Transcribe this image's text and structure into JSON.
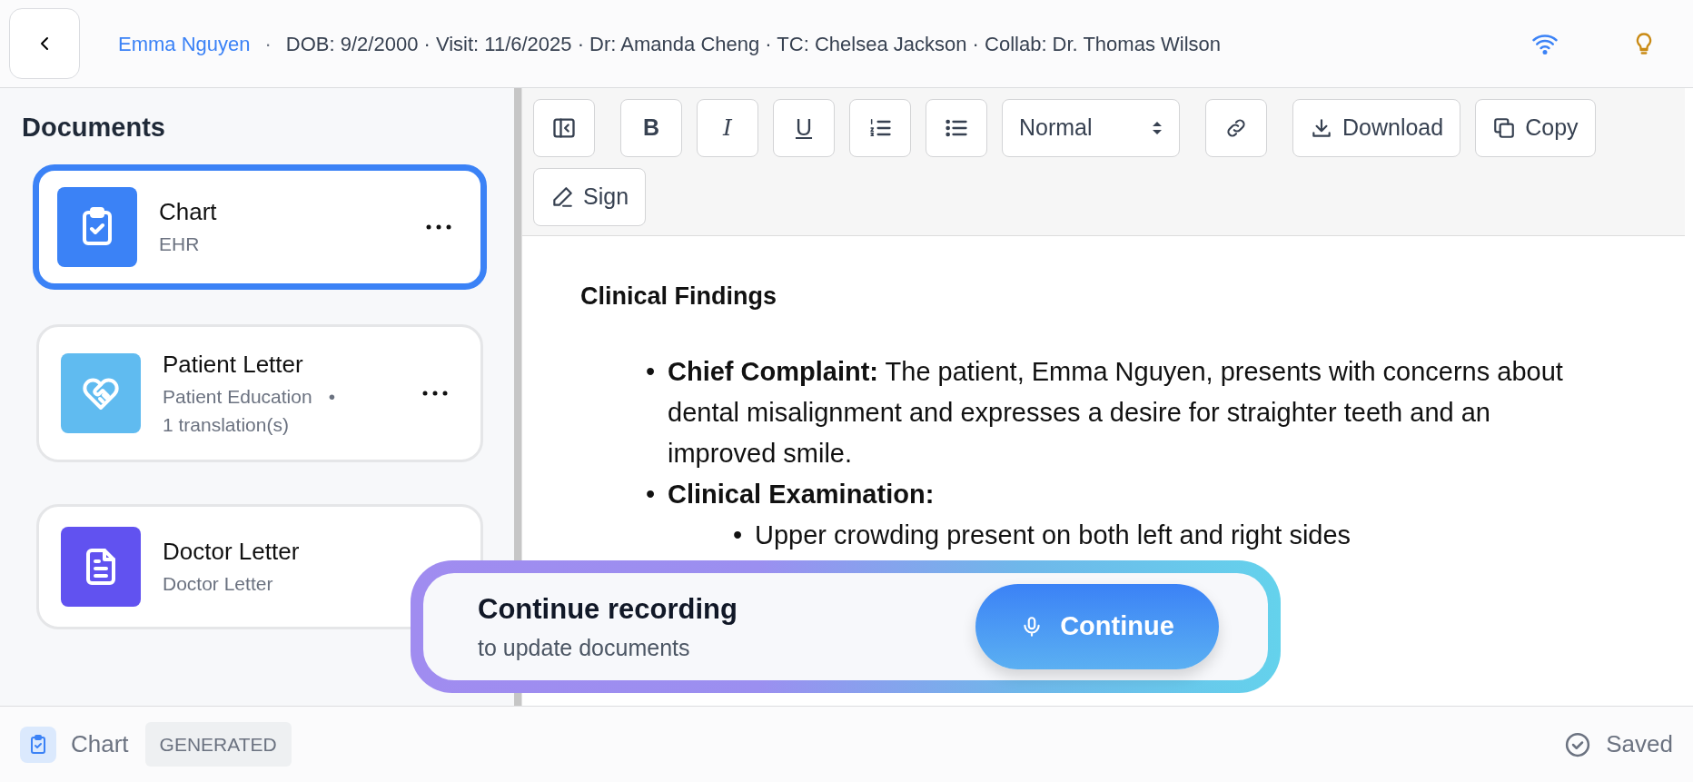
{
  "header": {
    "patient_name": "Emma Nguyen",
    "separator": "·",
    "details": "DOB: 9/2/2000 · Visit: 11/6/2025 · Dr: Amanda Cheng · TC: Chelsea Jackson · Collab: Dr. Thomas Wilson"
  },
  "sidebar": {
    "title": "Documents",
    "documents": [
      {
        "title": "Chart",
        "subtitle": "EHR",
        "kind": "clipboard",
        "color": "#3b82f6",
        "selected": true,
        "menu": true
      },
      {
        "title": "Patient Letter",
        "subtitle": "Patient Education",
        "bullet": "•",
        "extra": "1 translation(s)",
        "kind": "heart",
        "color": "#60bbf0",
        "selected": false,
        "menu": true
      },
      {
        "title": "Doctor Letter",
        "subtitle": "Doctor Letter",
        "kind": "file",
        "color": "#6152f0",
        "selected": false,
        "menu": false
      }
    ]
  },
  "toolbar": {
    "items": [
      {
        "kind": "panel"
      },
      {
        "kind": "bold",
        "label": "B"
      },
      {
        "kind": "italic",
        "label": "I"
      },
      {
        "kind": "underline",
        "label": "U"
      },
      {
        "kind": "ordered"
      },
      {
        "kind": "bullets"
      },
      {
        "kind": "select",
        "label": "Normal"
      },
      {
        "kind": "link"
      },
      {
        "kind": "download",
        "label": "Download"
      },
      {
        "kind": "copy",
        "label": "Copy"
      },
      {
        "kind": "sign",
        "label": "Sign"
      }
    ]
  },
  "editor": {
    "heading": "Clinical Findings",
    "items": [
      {
        "marker": "•",
        "text": "**Chief Complaint:** The patient, Emma Nguyen, presents with concerns about dental misalignment and expresses a desire for straighter teeth and an improved smile."
      },
      {
        "marker": "•",
        "text": "**Clinical Examination:**",
        "children": [
          {
            "marker": "•",
            "text": "Upper crowding present on both left and right sides"
          }
        ]
      }
    ]
  },
  "overlay": {
    "title": "Continue recording",
    "subtitle": "to update documents",
    "button": "Continue"
  },
  "footer": {
    "document": "Chart",
    "badge": "GENERATED",
    "status": "Saved"
  }
}
